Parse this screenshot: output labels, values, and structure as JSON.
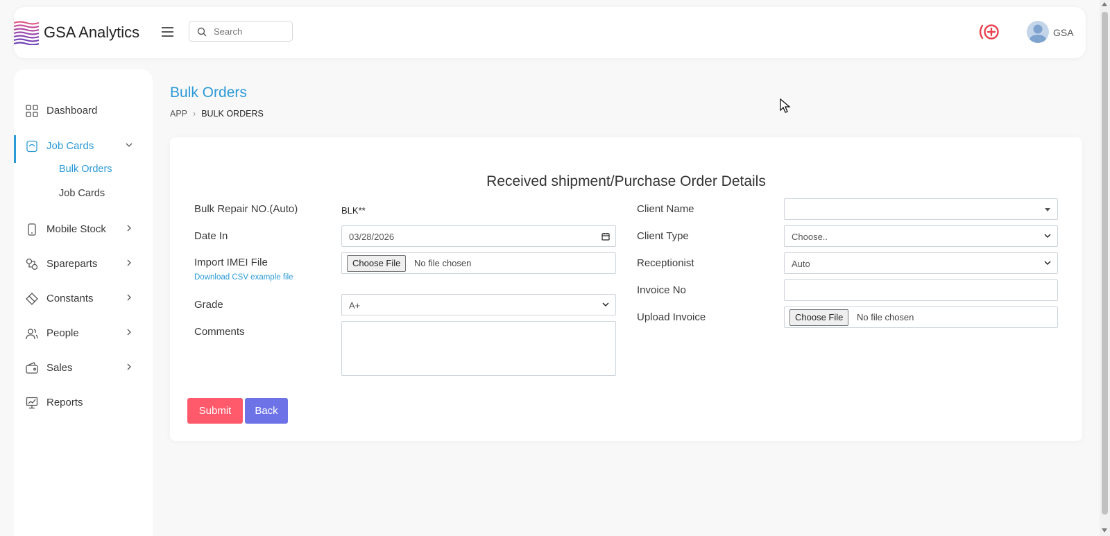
{
  "header": {
    "brand": "GSA Analytics",
    "search_placeholder": "Search",
    "user_name": "GSA"
  },
  "sidebar": {
    "items": [
      {
        "label": "Dashboard",
        "icon": "grid-icon"
      },
      {
        "label": "Job Cards",
        "icon": "job-card-icon",
        "expanded": true
      },
      {
        "label": "Mobile Stock",
        "icon": "mobile-icon"
      },
      {
        "label": "Spareparts",
        "icon": "spareparts-icon"
      },
      {
        "label": "Constants",
        "icon": "constants-icon"
      },
      {
        "label": "People",
        "icon": "people-icon"
      },
      {
        "label": "Sales",
        "icon": "wallet-icon"
      },
      {
        "label": "Reports",
        "icon": "reports-icon"
      }
    ],
    "sub_items": [
      {
        "label": "Bulk Orders",
        "active": true
      },
      {
        "label": "Job Cards",
        "active": false
      }
    ]
  },
  "page": {
    "title": "Bulk Orders",
    "breadcrumb": [
      "APP",
      "BULK ORDERS"
    ]
  },
  "form": {
    "title": "Received shipment/Purchase Order Details",
    "bulk_repair_label": "Bulk Repair NO.(Auto)",
    "bulk_repair_value": "BLK**",
    "date_in_label": "Date In",
    "date_in_value": "03/28/2026",
    "import_imei_label": "Import IMEI File",
    "download_csv_link": "Download CSV example file",
    "choose_file_label": "Choose File",
    "no_file_chosen": "No file chosen",
    "grade_label": "Grade",
    "grade_value": "A+",
    "comments_label": "Comments",
    "comments_value": "",
    "client_name_label": "Client Name",
    "client_name_value": "",
    "client_type_label": "Client Type",
    "client_type_value": "Choose..",
    "receptionist_label": "Receptionist",
    "receptionist_value": "Auto",
    "invoice_no_label": "Invoice No",
    "invoice_no_value": "",
    "upload_invoice_label": "Upload Invoice",
    "submit_label": "Submit",
    "back_label": "Back"
  },
  "colors": {
    "accent": "#2b9ad6",
    "submit": "#ff5a6b",
    "back": "#6d73e7",
    "notify": "#e8404e"
  }
}
